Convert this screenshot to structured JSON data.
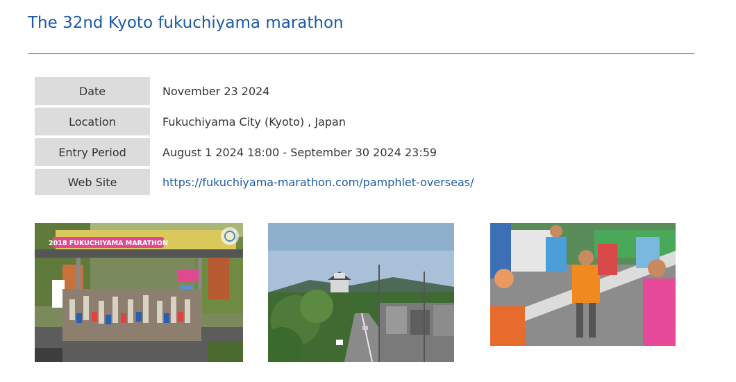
{
  "event": {
    "title": "The 32nd Kyoto fukuchiyama marathon",
    "info": [
      {
        "label": "Date",
        "value": "November 23 2024"
      },
      {
        "label": "Location",
        "value": "Fukuchiyama City (Kyoto) , Japan"
      },
      {
        "label": "Entry Period",
        "value": "August 1 2024 18:00 - September 30 2024 23:59"
      },
      {
        "label": "Web Site",
        "value": "https://fukuchiyama-marathon.com/pamphlet-overseas/"
      }
    ]
  },
  "photos": {
    "start_line": {
      "banner_text": "2018 FUKUCHIYAMA MARATHON",
      "zoom_icon": "camera-focus-icon"
    },
    "castle_street": {},
    "finish_runners": {}
  },
  "colors": {
    "title": "#1a5aa6",
    "rule": "#1d4f91",
    "label_bg": "#dcdcdc",
    "text": "#333333",
    "link": "#1a5aa6",
    "banner": "#e0498f"
  }
}
